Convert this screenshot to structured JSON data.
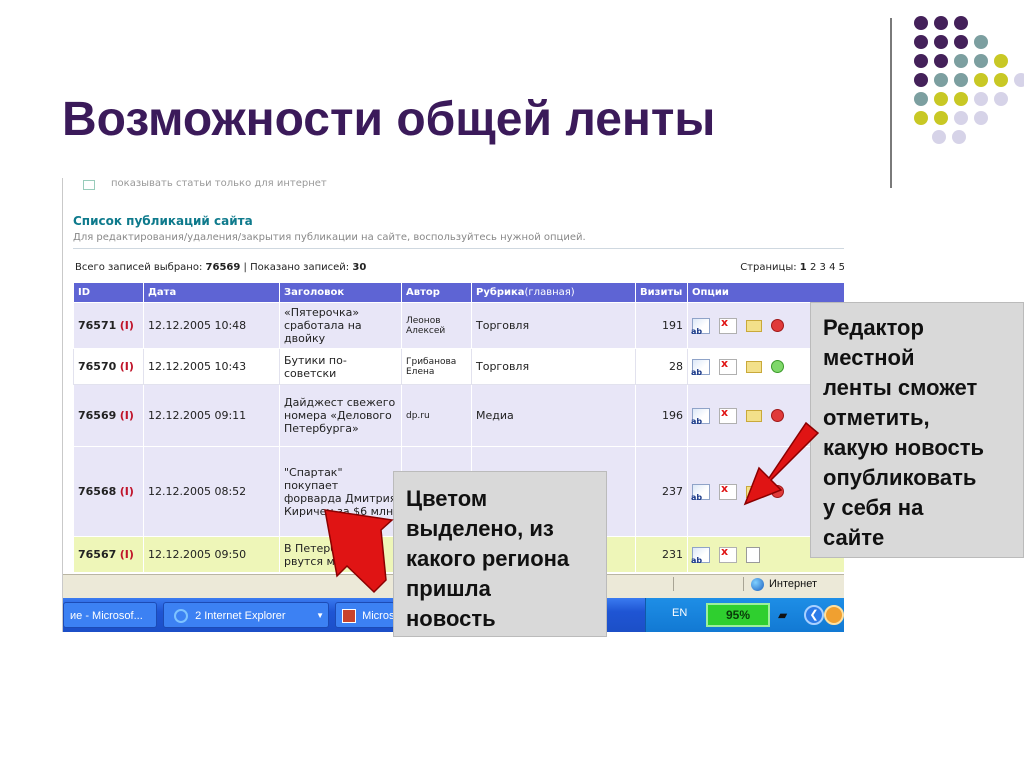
{
  "slide": {
    "title": "Возможности общей ленты",
    "dot_colors": {
      "purple": "#44215a",
      "teal": "#7c9fa0",
      "olive": "#c8c825",
      "lilac": "#d6d3e8"
    }
  },
  "screenshot": {
    "scrolled_text": "показывать статьи только для интернет",
    "list_title": "Список публикаций сайта",
    "list_subtitle": "Для редактирования/удаления/закрытия публикации на сайте, воспользуйтесь нужной опцией.",
    "counts": {
      "selected_label": "Всего записей выбрано:",
      "selected_value": "76569",
      "shown_label": "Показано записей:",
      "shown_value": "30"
    },
    "pages": {
      "label": "Страницы:",
      "current": "1",
      "others": [
        "2",
        "3",
        "4",
        "5"
      ]
    },
    "table": {
      "headers": {
        "id": "ID",
        "date": "Дата",
        "title": "Заголовок",
        "author": "Автор",
        "rubric": "Рубрика",
        "rubric_sub": "(главная)",
        "visits": "Визиты",
        "options": "Опции"
      },
      "rows": [
        {
          "id": "76571",
          "mark": "(I)",
          "date": "12.12.2005 10:48",
          "title": "«Пятерочка» сработала на двойку",
          "author": "Леонов Алексей",
          "rubric": "Торговля",
          "visits": "191",
          "color": "purple",
          "icons": [
            "edit-icon",
            "delete-icon",
            "mail-icon",
            "close-circle-icon"
          ]
        },
        {
          "id": "76570",
          "mark": "(I)",
          "date": "12.12.2005 10:43",
          "title": "Бутики по-советски",
          "author": "Грибанова Елена",
          "rubric": "Торговля",
          "visits": "28",
          "color": "white",
          "icons": [
            "edit-icon",
            "delete-icon",
            "mail-icon",
            "ok-circle-icon"
          ]
        },
        {
          "id": "76569",
          "mark": "(I)",
          "date": "12.12.2005 09:11",
          "title": "Дайджест свежего номера «Делового Петербурга»",
          "author": "dp.ru",
          "rubric": "Медиа",
          "visits": "196",
          "color": "purple",
          "icons": [
            "edit-icon",
            "delete-icon",
            "mail-icon",
            "close-circle-icon"
          ]
        },
        {
          "id": "76568",
          "mark": "(I)",
          "date": "12.12.2005 08:52",
          "title": "\"Спартак\" покупает форварда Дмитрия Киричен за $6 млн",
          "author": "",
          "rubric": "",
          "visits": "237",
          "color": "purple",
          "icons": [
            "edit-icon",
            "delete-icon",
            "mail-icon",
            "close-circle-icon"
          ]
        },
        {
          "id": "76567",
          "mark": "(I)",
          "date": "12.12.2005 09:50",
          "title": "В Петербурге рвутся магазин",
          "author": "",
          "rubric": "",
          "visits": "231",
          "color": "yellow",
          "icons": [
            "edit-icon",
            "delete-icon",
            "doc-icon"
          ]
        }
      ]
    },
    "statusbar": {
      "zone": "Интернет"
    },
    "taskbar": {
      "task1": "ие - Microsof...",
      "task2_count": "2",
      "task2": "Internet Explorer",
      "task3": "Microso",
      "lang": "EN",
      "battery": "95%"
    }
  },
  "callouts": {
    "right": [
      "Редактор",
      "местной",
      "ленты сможет",
      "отметить,",
      "какую новость",
      "опубликовать",
      "у себя на",
      "сайте"
    ],
    "left": [
      "Цветом",
      "выделено, из",
      "какого региона",
      "пришла",
      "новость"
    ]
  }
}
